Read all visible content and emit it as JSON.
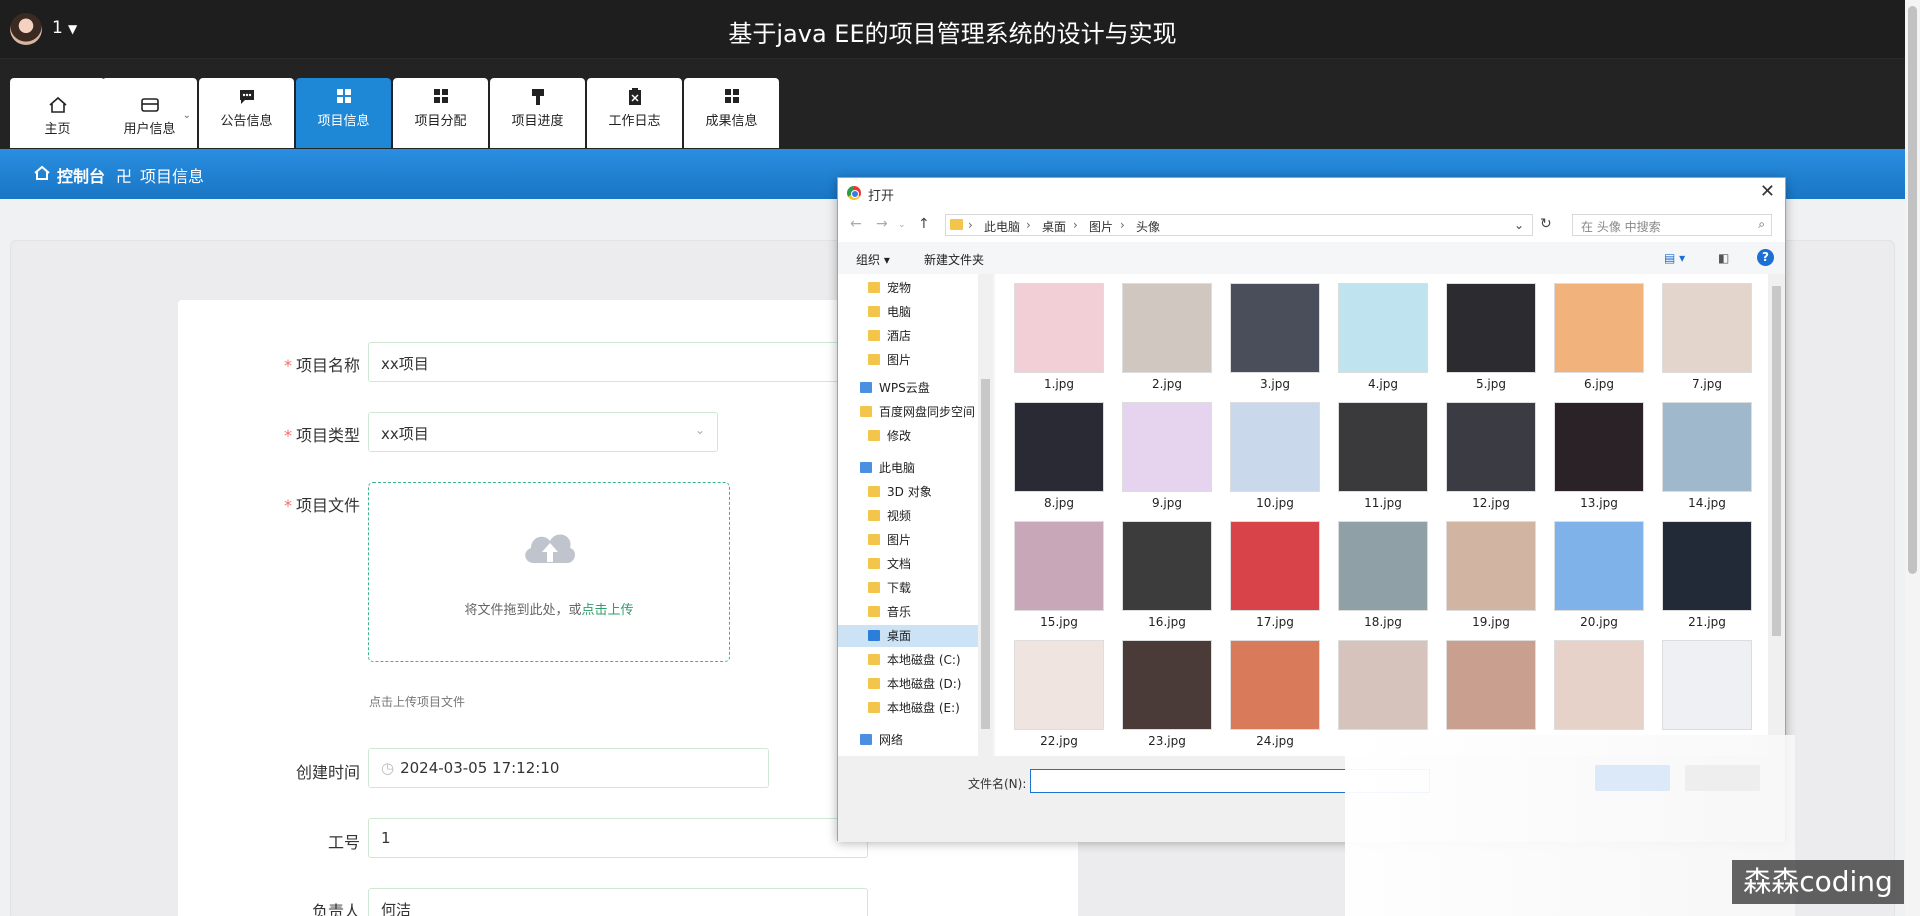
{
  "header": {
    "user_name": "1",
    "caret": "▼",
    "title": "基于java EE的项目管理系统的设计与实现"
  },
  "nav": [
    {
      "label": "主页",
      "icon": "home-icon"
    },
    {
      "label": "用户信息",
      "icon": "wallet-icon"
    },
    {
      "label": "公告信息",
      "icon": "chat-icon"
    },
    {
      "label": "项目信息",
      "icon": "grid-icon"
    },
    {
      "label": "项目分配",
      "icon": "grid-icon"
    },
    {
      "label": "项目进度",
      "icon": "brush-icon"
    },
    {
      "label": "工作日志",
      "icon": "clipboard-icon"
    },
    {
      "label": "成果信息",
      "icon": "grid-icon"
    }
  ],
  "breadcrumb": {
    "home": "控制台",
    "sep": "卍",
    "current": "项目信息"
  },
  "form": {
    "name_label": "项目名称",
    "name_value": "xx项目",
    "type_label": "项目类型",
    "type_value": "xx项目",
    "file_label": "项目文件",
    "upload_text": "将文件拖到此处，或",
    "upload_link": "点击上传",
    "upload_hint": "点击上传项目文件",
    "created_label": "创建时间",
    "created_value": "2024-03-05 17:12:10",
    "job_label": "工号",
    "job_value": "1",
    "owner_label": "负责人",
    "owner_value": "何洁"
  },
  "dialog": {
    "title": "打开",
    "path": [
      "此电脑",
      "桌面",
      "图片",
      "头像"
    ],
    "search_placeholder": "在 头像 中搜索",
    "organize": "组织 ▾",
    "new_folder": "新建文件夹",
    "help": "?",
    "tree": [
      {
        "label": "宠物",
        "sel": false
      },
      {
        "label": "电脑",
        "sel": false
      },
      {
        "label": "酒店",
        "sel": false
      },
      {
        "label": "图片",
        "sel": false
      },
      {
        "label": "WPS云盘",
        "sel": false
      },
      {
        "label": "百度网盘同步空间",
        "sel": false
      },
      {
        "label": "修改",
        "sel": false
      },
      {
        "label": "此电脑",
        "sel": false
      },
      {
        "label": "3D 对象",
        "sel": false
      },
      {
        "label": "视频",
        "sel": false
      },
      {
        "label": "图片",
        "sel": false
      },
      {
        "label": "文档",
        "sel": false
      },
      {
        "label": "下载",
        "sel": false
      },
      {
        "label": "音乐",
        "sel": false
      },
      {
        "label": "桌面",
        "sel": true
      },
      {
        "label": "本地磁盘 (C:)",
        "sel": false
      },
      {
        "label": "本地磁盘 (D:)",
        "sel": false
      },
      {
        "label": "本地磁盘 (E:)",
        "sel": false
      },
      {
        "label": "网络",
        "sel": false
      }
    ],
    "files": [
      "1.jpg",
      "2.jpg",
      "3.jpg",
      "4.jpg",
      "5.jpg",
      "6.jpg",
      "7.jpg",
      "8.jpg",
      "9.jpg",
      "10.jpg",
      "11.jpg",
      "12.jpg",
      "13.jpg",
      "14.jpg",
      "15.jpg",
      "16.jpg",
      "17.jpg",
      "18.jpg",
      "19.jpg",
      "20.jpg",
      "21.jpg",
      "22.jpg",
      "23.jpg",
      "24.jpg",
      "",
      "",
      "",
      ""
    ],
    "thumb_colors": [
      "#f2cfd6",
      "#cfc7c0",
      "#4a4e5a",
      "#bfe3ef",
      "#2b2b30",
      "#f2b27c",
      "#e3d4cc",
      "#2a2a35",
      "#e6d3ee",
      "#c9d8ea",
      "#3a3a3c",
      "#3b3b44",
      "#2a2226",
      "#9fb8cc",
      "#c7a7b8",
      "#3c3c3c",
      "#d8434a",
      "#8fa0a6",
      "#d2b4a2",
      "#7fb2e8",
      "#222a38",
      "#f0e4e0",
      "#4a3a38",
      "#d97a5a",
      "#d6c4bc",
      "#c9a090",
      "#e6d2c8",
      "#eef0f4"
    ],
    "filename_label": "文件名(N):",
    "filename_value": ""
  },
  "watermark": "森森coding"
}
